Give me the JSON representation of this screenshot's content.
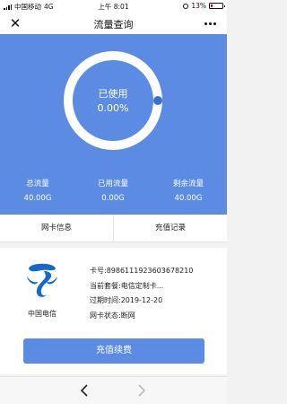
{
  "status_bar": {
    "carrier": "中国移动",
    "network": "4G",
    "time": "上午 8:01",
    "battery": "13%",
    "battery_level": 0.13
  },
  "nav": {
    "title": "流量查询",
    "close_icon": "close-icon",
    "more_icon": "more-icon"
  },
  "usage": {
    "ring_label": "已使用",
    "ring_value": "0.00%",
    "used_fraction": 0.0,
    "stats": [
      {
        "label": "总流量",
        "value": "40.00G"
      },
      {
        "label": "已用流量",
        "value": "0.00G"
      },
      {
        "label": "剩余流量",
        "value": "40.00G"
      }
    ]
  },
  "tabs": [
    {
      "label": "网卡信息"
    },
    {
      "label": "充值记录"
    }
  ],
  "card": {
    "carrier_name": "中国电信",
    "card_number": "卡号:8986111923603678210",
    "plan": "当前套餐:电信定制卡...",
    "expiry": "过期时间:2019-12-20",
    "status": "网卡状态:断网"
  },
  "recharge_button": "充值续费",
  "bottom_nav": {
    "back_icon": "chevron-left-icon",
    "forward_icon": "chevron-right-icon"
  },
  "colors": {
    "accent": "#5b8be3",
    "ring_knob": "#3c6fd6",
    "telecom_logo": "#1468c8"
  }
}
